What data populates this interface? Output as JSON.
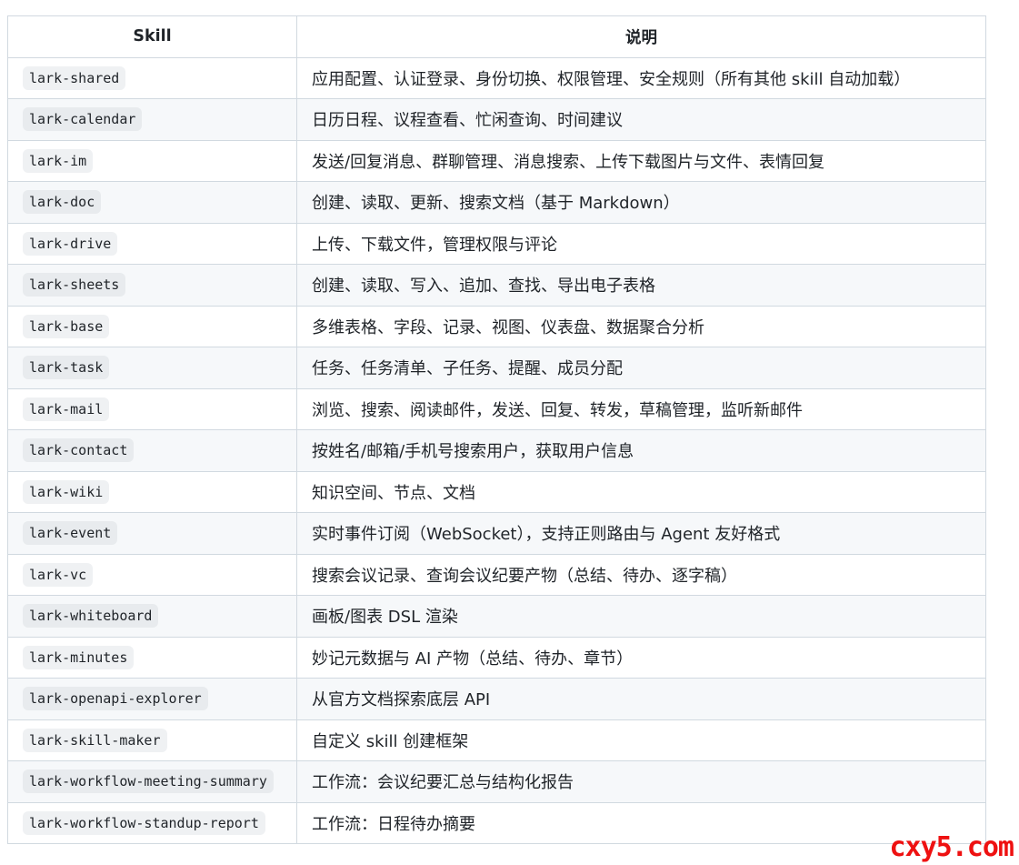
{
  "table": {
    "headers": [
      "Skill",
      "说明"
    ],
    "rows": [
      {
        "skill": "lark-shared",
        "desc": "应用配置、认证登录、身份切换、权限管理、安全规则（所有其他 skill 自动加载）"
      },
      {
        "skill": "lark-calendar",
        "desc": "日历日程、议程查看、忙闲查询、时间建议"
      },
      {
        "skill": "lark-im",
        "desc": "发送/回复消息、群聊管理、消息搜索、上传下载图片与文件、表情回复"
      },
      {
        "skill": "lark-doc",
        "desc": "创建、读取、更新、搜索文档（基于 Markdown）"
      },
      {
        "skill": "lark-drive",
        "desc": "上传、下载文件，管理权限与评论"
      },
      {
        "skill": "lark-sheets",
        "desc": "创建、读取、写入、追加、查找、导出电子表格"
      },
      {
        "skill": "lark-base",
        "desc": "多维表格、字段、记录、视图、仪表盘、数据聚合分析"
      },
      {
        "skill": "lark-task",
        "desc": "任务、任务清单、子任务、提醒、成员分配"
      },
      {
        "skill": "lark-mail",
        "desc": "浏览、搜索、阅读邮件，发送、回复、转发，草稿管理，监听新邮件"
      },
      {
        "skill": "lark-contact",
        "desc": "按姓名/邮箱/手机号搜索用户，获取用户信息"
      },
      {
        "skill": "lark-wiki",
        "desc": "知识空间、节点、文档"
      },
      {
        "skill": "lark-event",
        "desc": "实时事件订阅（WebSocket），支持正则路由与 Agent 友好格式"
      },
      {
        "skill": "lark-vc",
        "desc": "搜索会议记录、查询会议纪要产物（总结、待办、逐字稿）"
      },
      {
        "skill": "lark-whiteboard",
        "desc": "画板/图表 DSL 渲染"
      },
      {
        "skill": "lark-minutes",
        "desc": "妙记元数据与 AI 产物（总结、待办、章节）"
      },
      {
        "skill": "lark-openapi-explorer",
        "desc": "从官方文档探索底层 API"
      },
      {
        "skill": "lark-skill-maker",
        "desc": "自定义 skill 创建框架"
      },
      {
        "skill": "lark-workflow-meeting-summary",
        "desc": "工作流：会议纪要汇总与结构化报告"
      },
      {
        "skill": "lark-workflow-standup-report",
        "desc": "工作流：日程待办摘要"
      }
    ]
  },
  "watermark": "cxy5.com",
  "colors": {
    "border": "#d1d9e0",
    "stripe": "#f6f8fa",
    "code_bg": "#eff1f3",
    "watermark": "#ee1111"
  }
}
